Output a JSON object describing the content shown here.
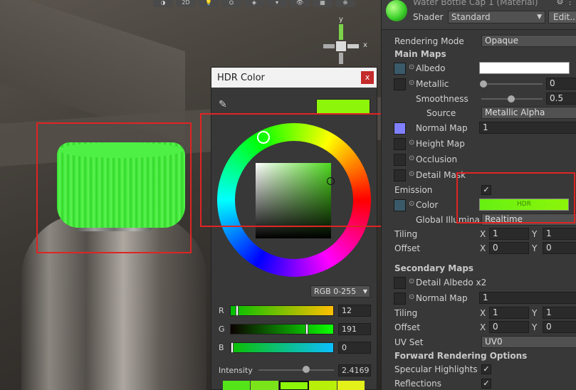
{
  "scene": {
    "toolbar": [
      "◑",
      "2D",
      "💡",
      "⛭",
      "◈",
      "▾",
      "👁",
      "▦",
      "⊕"
    ],
    "gizmo": {
      "y_label": "y",
      "x_label": "x"
    }
  },
  "hdr_picker": {
    "title": "HDR Color",
    "close_label": "x",
    "eyedropper_icon": "✎",
    "swatch_color": "#8cf50a",
    "mode": "RGB 0-255",
    "channels": [
      {
        "label": "R",
        "value": "12",
        "level": 0.047
      },
      {
        "label": "G",
        "value": "191",
        "level": 0.749
      },
      {
        "label": "B",
        "value": "0",
        "level": 0.0
      }
    ],
    "intensity_label": "Intensity",
    "intensity_value": "2.4169",
    "presets": [
      "#55e31a",
      "#7be31a",
      "#8cf50a",
      "#b8f00a",
      "#e3f01a"
    ]
  },
  "inspector": {
    "title": "Water Bottle Cap 1 (Material)",
    "header_buttons": "⚙ ⋮",
    "shader_label": "Shader",
    "shader_value": "Standard",
    "edit_label": "Edit...",
    "rendering_mode_label": "Rendering Mode",
    "rendering_mode_value": "Opaque",
    "main_maps_label": "Main Maps",
    "albedo_label": "Albedo",
    "metallic_label": "Metallic",
    "metallic_value": "0",
    "smoothness_label": "Smoothness",
    "smoothness_value": "0.5",
    "source_label": "Source",
    "source_value": "Metallic Alpha",
    "normal_map_label": "Normal Map",
    "normal_map_value": "1",
    "height_map_label": "Height Map",
    "occlusion_label": "Occlusion",
    "detail_mask_label": "Detail Mask",
    "emission_label": "Emission",
    "color_label": "Color",
    "hdr_badge": "HDR",
    "global_illum_label": "Global Illuminati",
    "global_illum_value": "Realtime",
    "tiling_label": "Tiling",
    "offset_label": "Offset",
    "x": "X",
    "y": "Y",
    "main_tiling": [
      "1",
      "1"
    ],
    "main_offset": [
      "0",
      "0"
    ],
    "secondary_maps_label": "Secondary Maps",
    "detail_albedo_label": "Detail Albedo x2",
    "sec_normal_label": "Normal Map",
    "sec_normal_value": "1",
    "sec_tiling": [
      "1",
      "1"
    ],
    "sec_offset": [
      "0",
      "0"
    ],
    "uv_set_label": "UV Set",
    "uv_set_value": "UV0",
    "forward_label": "Forward Rendering Options",
    "specular_label": "Specular Highlights",
    "reflections_label": "Reflections",
    "checkmark": "✓",
    "dropdown_arrow": "▼",
    "dot": "⊙"
  }
}
